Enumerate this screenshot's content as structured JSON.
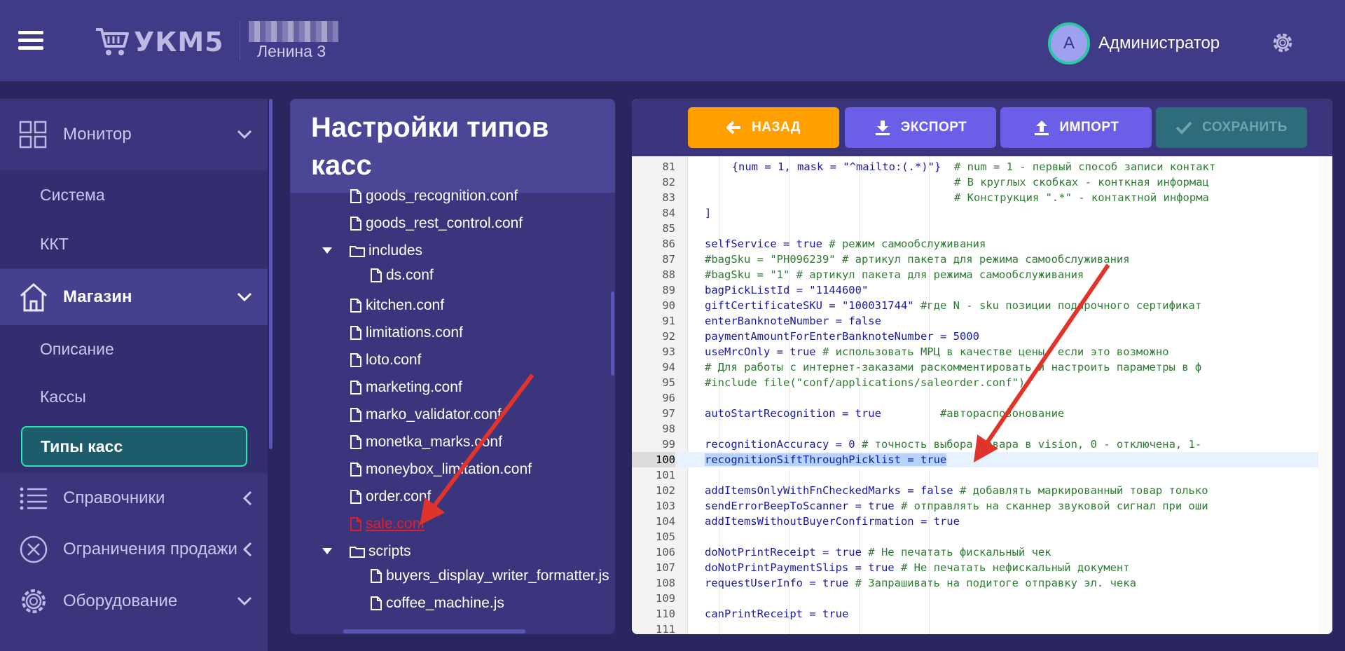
{
  "header": {
    "logo_text": "УКМ5",
    "store_name": "Ленина 3",
    "avatar_letter": "А",
    "user_name": "Администратор"
  },
  "sidebar": {
    "monitor": "Монитор",
    "system": "Система",
    "kkt": "ККТ",
    "store": "Магазин",
    "description": "Описание",
    "registers": "Кассы",
    "register_types": "Типы касс",
    "directories": "Справочники",
    "sales_restrictions": "Ограничения продажи",
    "equipment": "Оборудование"
  },
  "tree": {
    "title": "Настройки типов касс",
    "items": [
      {
        "label": "goods_recognition.conf",
        "kind": "file"
      },
      {
        "label": "goods_rest_control.conf",
        "kind": "file"
      },
      {
        "label": "includes",
        "kind": "folder"
      },
      {
        "label": "ds.conf",
        "kind": "file"
      },
      {
        "label": "kitchen.conf",
        "kind": "file"
      },
      {
        "label": "limitations.conf",
        "kind": "file"
      },
      {
        "label": "loto.conf",
        "kind": "file"
      },
      {
        "label": "marketing.conf",
        "kind": "file"
      },
      {
        "label": "marko_validator.conf",
        "kind": "file"
      },
      {
        "label": "monetka_marks.conf",
        "kind": "file"
      },
      {
        "label": "moneybox_limitation.conf",
        "kind": "file"
      },
      {
        "label": "order.conf",
        "kind": "file"
      },
      {
        "label": "sale.conf",
        "kind": "file"
      },
      {
        "label": "scripts",
        "kind": "folder"
      },
      {
        "label": "buyers_display_writer_formatter.js",
        "kind": "file"
      },
      {
        "label": "coffee_machine.js",
        "kind": "file"
      }
    ]
  },
  "toolbar": {
    "back": "НАЗАД",
    "export": "ЭКСПОРТ",
    "import": "ИМПОРТ",
    "save": "СОХРАНИТЬ"
  },
  "editor": {
    "lines": [
      {
        "n": "81",
        "code": "  {num = 1, mask = \"^mailto:(.*)\"}",
        "comment": "  # num = 1 - первый способ записи контакт"
      },
      {
        "n": "82",
        "code": "                                  ",
        "comment": "  # В круглых скобках - конткная информац"
      },
      {
        "n": "83",
        "code": "                                  ",
        "comment": "  # Конструкция \".*\" - контактной информа"
      },
      {
        "n": "84",
        "code": "]",
        "comment": ""
      },
      {
        "n": "85",
        "code": "",
        "comment": ""
      },
      {
        "n": "86",
        "code": "selfService = true",
        "comment": " # режим самообслуживания"
      },
      {
        "n": "87",
        "code": "",
        "comment": "#bagSku = \"PH096239\" # артикул пакета для режима самообслуживания"
      },
      {
        "n": "88",
        "code": "",
        "comment": "#bagSku = \"1\" # артикул пакета для режима самообслуживания"
      },
      {
        "n": "89",
        "code": "bagPickListId = \"1144600\"",
        "comment": ""
      },
      {
        "n": "90",
        "code": "giftCertificateSKU = \"100031744\"",
        "comment": " #где N - sku позиции подарочного сертификат"
      },
      {
        "n": "91",
        "code": "enterBanknoteNumber = false",
        "comment": ""
      },
      {
        "n": "92",
        "code": "paymentAmountForEnterBanknoteNumber = 5000",
        "comment": ""
      },
      {
        "n": "93",
        "code": "useMrcOnly = true",
        "comment": " # использовать МРЦ в качестве цены, если это возможно"
      },
      {
        "n": "94",
        "code": "",
        "comment": "# Для работы с интернет-заказами раскомментировать и настроить параметры в ф"
      },
      {
        "n": "95",
        "code": "",
        "comment": "#include file(\"conf/applications/saleorder.conf\")"
      },
      {
        "n": "96",
        "code": "",
        "comment": ""
      },
      {
        "n": "97",
        "code": "autoStartRecognition = true",
        "comment": "         #автораспозонование"
      },
      {
        "n": "98",
        "code": "",
        "comment": ""
      },
      {
        "n": "99",
        "code": "recognitionAccuracy = 0",
        "comment": " # точность выбора товара в vision, 0 - отключена, 1-"
      },
      {
        "n": "100",
        "code": "recognitionSiftThroughPicklist = true",
        "comment": ""
      },
      {
        "n": "101",
        "code": "",
        "comment": ""
      },
      {
        "n": "102",
        "code": "addItemsOnlyWithFnCheckedMarks = false",
        "comment": " # добавлять маркированный товар только"
      },
      {
        "n": "103",
        "code": "sendErrorBeepToScanner = true",
        "comment": " # отправлять на сканнер звуковой сигнал при оши"
      },
      {
        "n": "104",
        "code": "addItemsWithoutBuyerConfirmation = true",
        "comment": ""
      },
      {
        "n": "105",
        "code": "",
        "comment": ""
      },
      {
        "n": "106",
        "code": "doNotPrintReceipt = true",
        "comment": " # Не печатать фискальный чек"
      },
      {
        "n": "107",
        "code": "doNotPrintPaymentSlips = true",
        "comment": " # Не печатать нефискальный документ"
      },
      {
        "n": "108",
        "code": "requestUserInfo = true",
        "comment": " # Запрашивать на подитоге отправку эл. чека"
      },
      {
        "n": "109",
        "code": "",
        "comment": ""
      },
      {
        "n": "110",
        "code": "canPrintReceipt = true",
        "comment": ""
      },
      {
        "n": "111",
        "code": "",
        "comment": ""
      }
    ]
  },
  "colors": {
    "header_bg": "#403b87",
    "sidebar_bg": "#3a357c",
    "accent_teal": "#29e6b4",
    "back_orange": "#ffa000",
    "action_purple": "#6a5fe6",
    "save_disabled": "#2e6c7b",
    "highlight_red": "#e01f2a",
    "arrow_red": "#e0342b"
  }
}
